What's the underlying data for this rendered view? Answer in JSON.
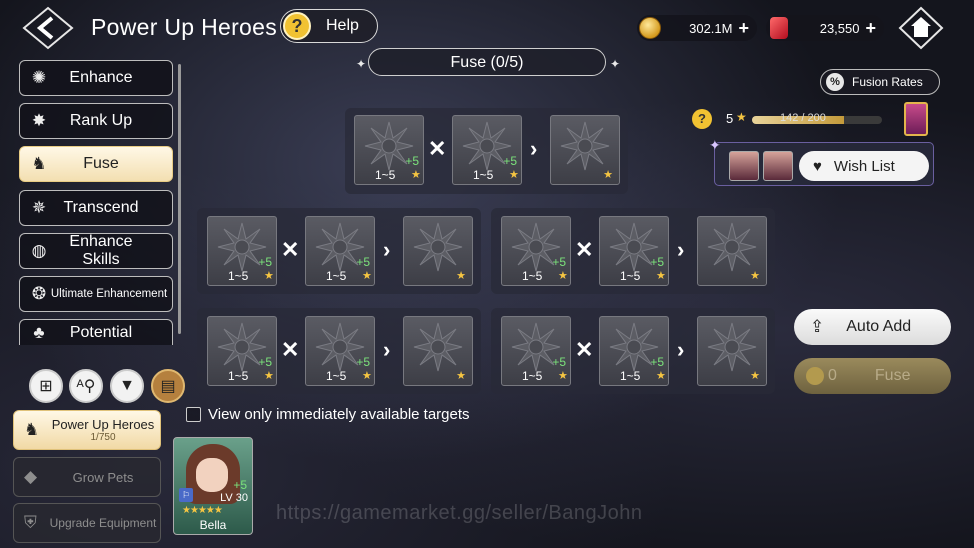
{
  "header": {
    "title": "Power Up Heroes",
    "help_label": "Help",
    "help_symbol": "?",
    "gold": "302.1M",
    "gems": "23,550",
    "plus_symbol": "+"
  },
  "fuse_panel": {
    "title": "Fuse (0/5)",
    "fusion_rates_label": "Fusion Rates",
    "fusion_rates_symbol": "%"
  },
  "sidebar": {
    "items": [
      {
        "label": "Enhance",
        "icon": "enhance-icon"
      },
      {
        "label": "Rank Up",
        "icon": "rank-up-icon"
      },
      {
        "label": "Fuse",
        "icon": "fuse-icon",
        "active": true
      },
      {
        "label": "Transcend",
        "icon": "transcend-icon"
      },
      {
        "label": "Enhance Skills",
        "icon": "skills-icon"
      },
      {
        "label": "Ultimate Enhancement",
        "icon": "ultimate-icon"
      },
      {
        "label": "Potential",
        "icon": "potential-icon"
      }
    ]
  },
  "modes": {
    "power_up": {
      "label": "Power Up Heroes",
      "count": "1/750"
    },
    "grow_pets": {
      "label": "Grow Pets"
    },
    "upgrade_equipment": {
      "label": "Upgrade Equipment"
    }
  },
  "slot_text": {
    "range": "1~5",
    "bonus": "+5"
  },
  "progress": {
    "help_symbol": "?",
    "level": "5",
    "value_text": "142 / 200",
    "fill_fraction": 0.71
  },
  "wish_list": {
    "label": "Wish List"
  },
  "actions": {
    "auto_add": "Auto Add",
    "fuse_cost": "0",
    "fuse": "Fuse"
  },
  "filter": {
    "label": "View only immediately available targets",
    "checked": false
  },
  "hero": {
    "name": "Bella",
    "level": "LV 30",
    "bonus": "+5",
    "stars": "★★★★★"
  },
  "watermark": "https://gamemarket.gg/seller/BangJohn",
  "colors": {
    "gold": "#f5c542",
    "accent": "#f3dfb1",
    "bonus_green": "#7be27b"
  }
}
